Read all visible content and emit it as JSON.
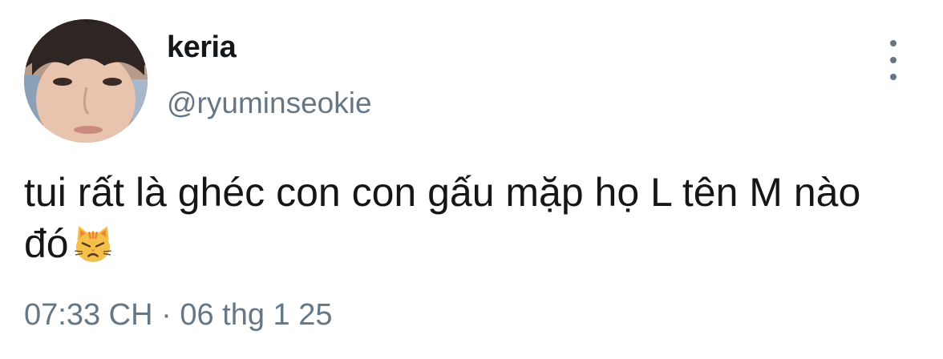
{
  "tweet": {
    "author": {
      "display_name": "keria",
      "handle": "@ryuminseokie",
      "avatar": "profile-photo"
    },
    "menu_icon": "more-vertical-icon",
    "text_line1": "tui rất là ghéc con con gấu mặp họ L tên M nào",
    "text_line2": "đó",
    "emoji": "pouting-cat-face-icon",
    "time": "07:33 CH",
    "separator": "·",
    "date": "06 thg 1 25"
  },
  "colors": {
    "primary_text": "#14171a",
    "secondary_text": "#657786",
    "background": "#ffffff"
  }
}
